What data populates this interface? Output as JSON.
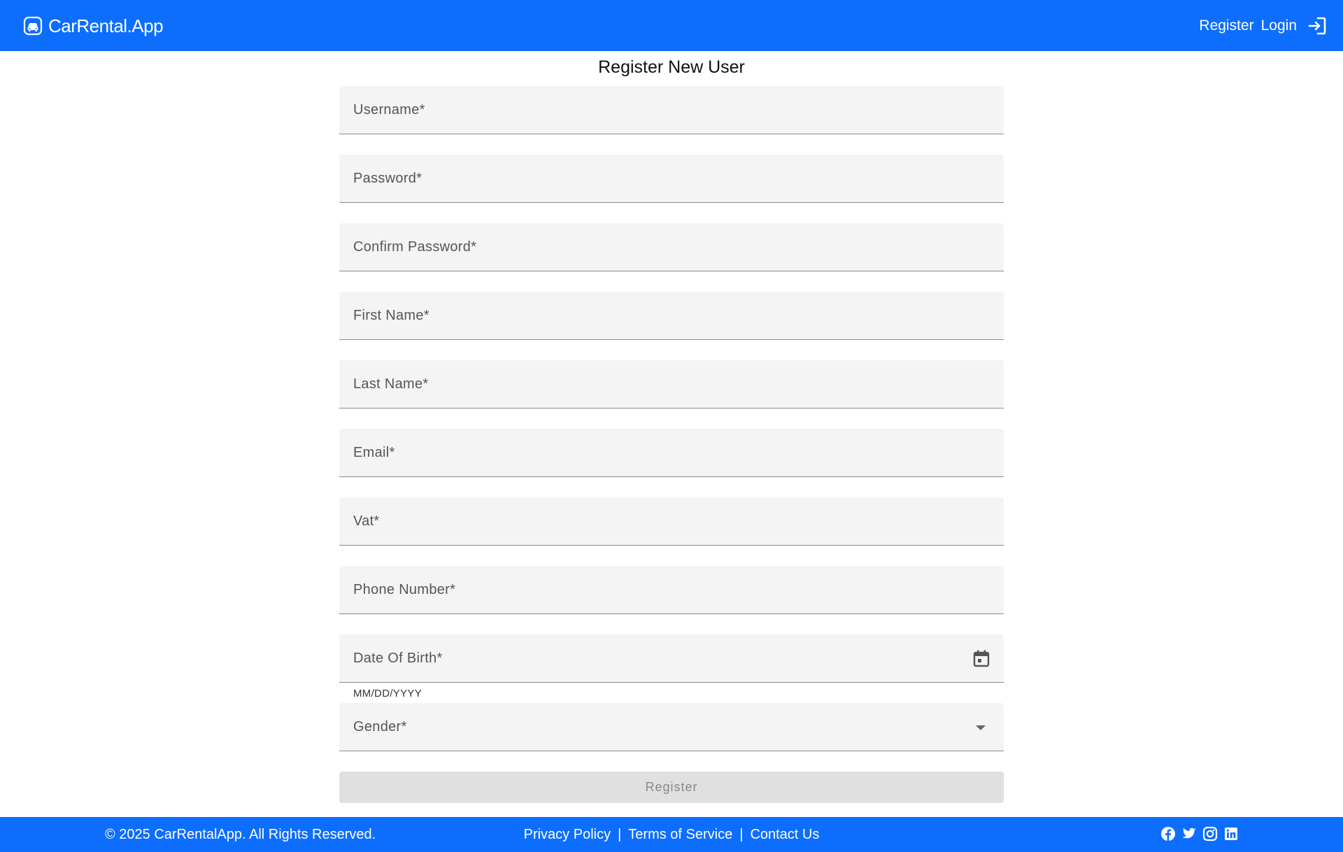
{
  "header": {
    "brand": "CarRental.App",
    "brand_icon": "car-icon",
    "nav": {
      "register_label": "Register",
      "login_label": "Login",
      "login_icon": "login-icon"
    },
    "bg_color": "#0d6efd"
  },
  "form": {
    "title": "Register New User",
    "fields": {
      "username": "Username*",
      "password": "Password*",
      "confirm_password": "Confirm Password*",
      "first_name": "First Name*",
      "last_name": "Last Name*",
      "email": "Email*",
      "vat": "Vat*",
      "phone": "Phone Number*",
      "dob": "Date Of Birth*",
      "dob_hint": "MM/DD/YYYY",
      "gender": "Gender*"
    },
    "submit_label": "Register"
  },
  "footer": {
    "copyright": "© 2025 CarRentalApp. All Rights Reserved.",
    "links": {
      "privacy": "Privacy Policy",
      "sep": "|",
      "terms": "Terms of Service",
      "contact": "Contact Us"
    },
    "social_icons": [
      "facebook-icon",
      "twitter-icon",
      "instagram-icon",
      "linkedin-icon"
    ]
  }
}
